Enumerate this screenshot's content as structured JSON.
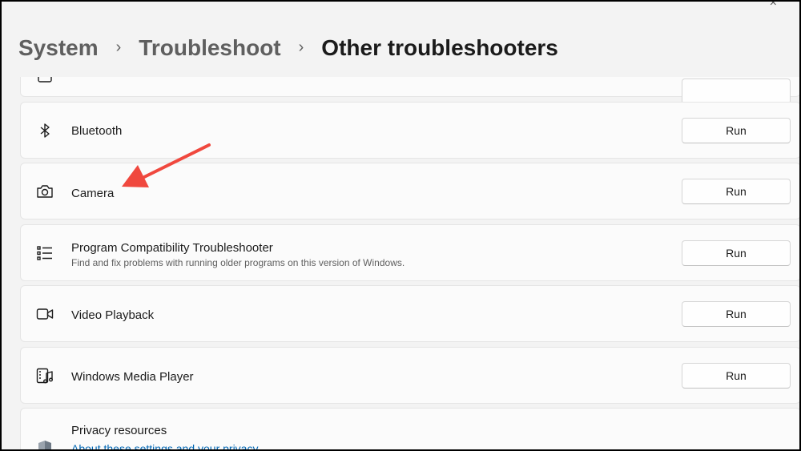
{
  "window": {
    "close_glyph": "×"
  },
  "breadcrumb": {
    "items": [
      "System",
      "Troubleshoot",
      "Other troubleshooters"
    ],
    "separator": "›"
  },
  "troubleshooters": [
    {
      "title": "Bluetooth",
      "subtitle": "",
      "icon": "bluetooth-icon",
      "button": "Run"
    },
    {
      "title": "Camera",
      "subtitle": "",
      "icon": "camera-icon",
      "button": "Run"
    },
    {
      "title": "Program Compatibility Troubleshooter",
      "subtitle": "Find and fix problems with running older programs on this version of Windows.",
      "icon": "list-icon",
      "button": "Run"
    },
    {
      "title": "Video Playback",
      "subtitle": "",
      "icon": "video-icon",
      "button": "Run"
    },
    {
      "title": "Windows Media Player",
      "subtitle": "",
      "icon": "media-player-icon",
      "button": "Run"
    }
  ],
  "privacy": {
    "title": "Privacy resources",
    "link": "About these settings and your privacy",
    "icon": "shield-icon"
  },
  "colors": {
    "background": "#f3f3f3",
    "card": "#fbfbfb",
    "link": "#0066b4",
    "annotation_arrow": "#f0483e"
  }
}
